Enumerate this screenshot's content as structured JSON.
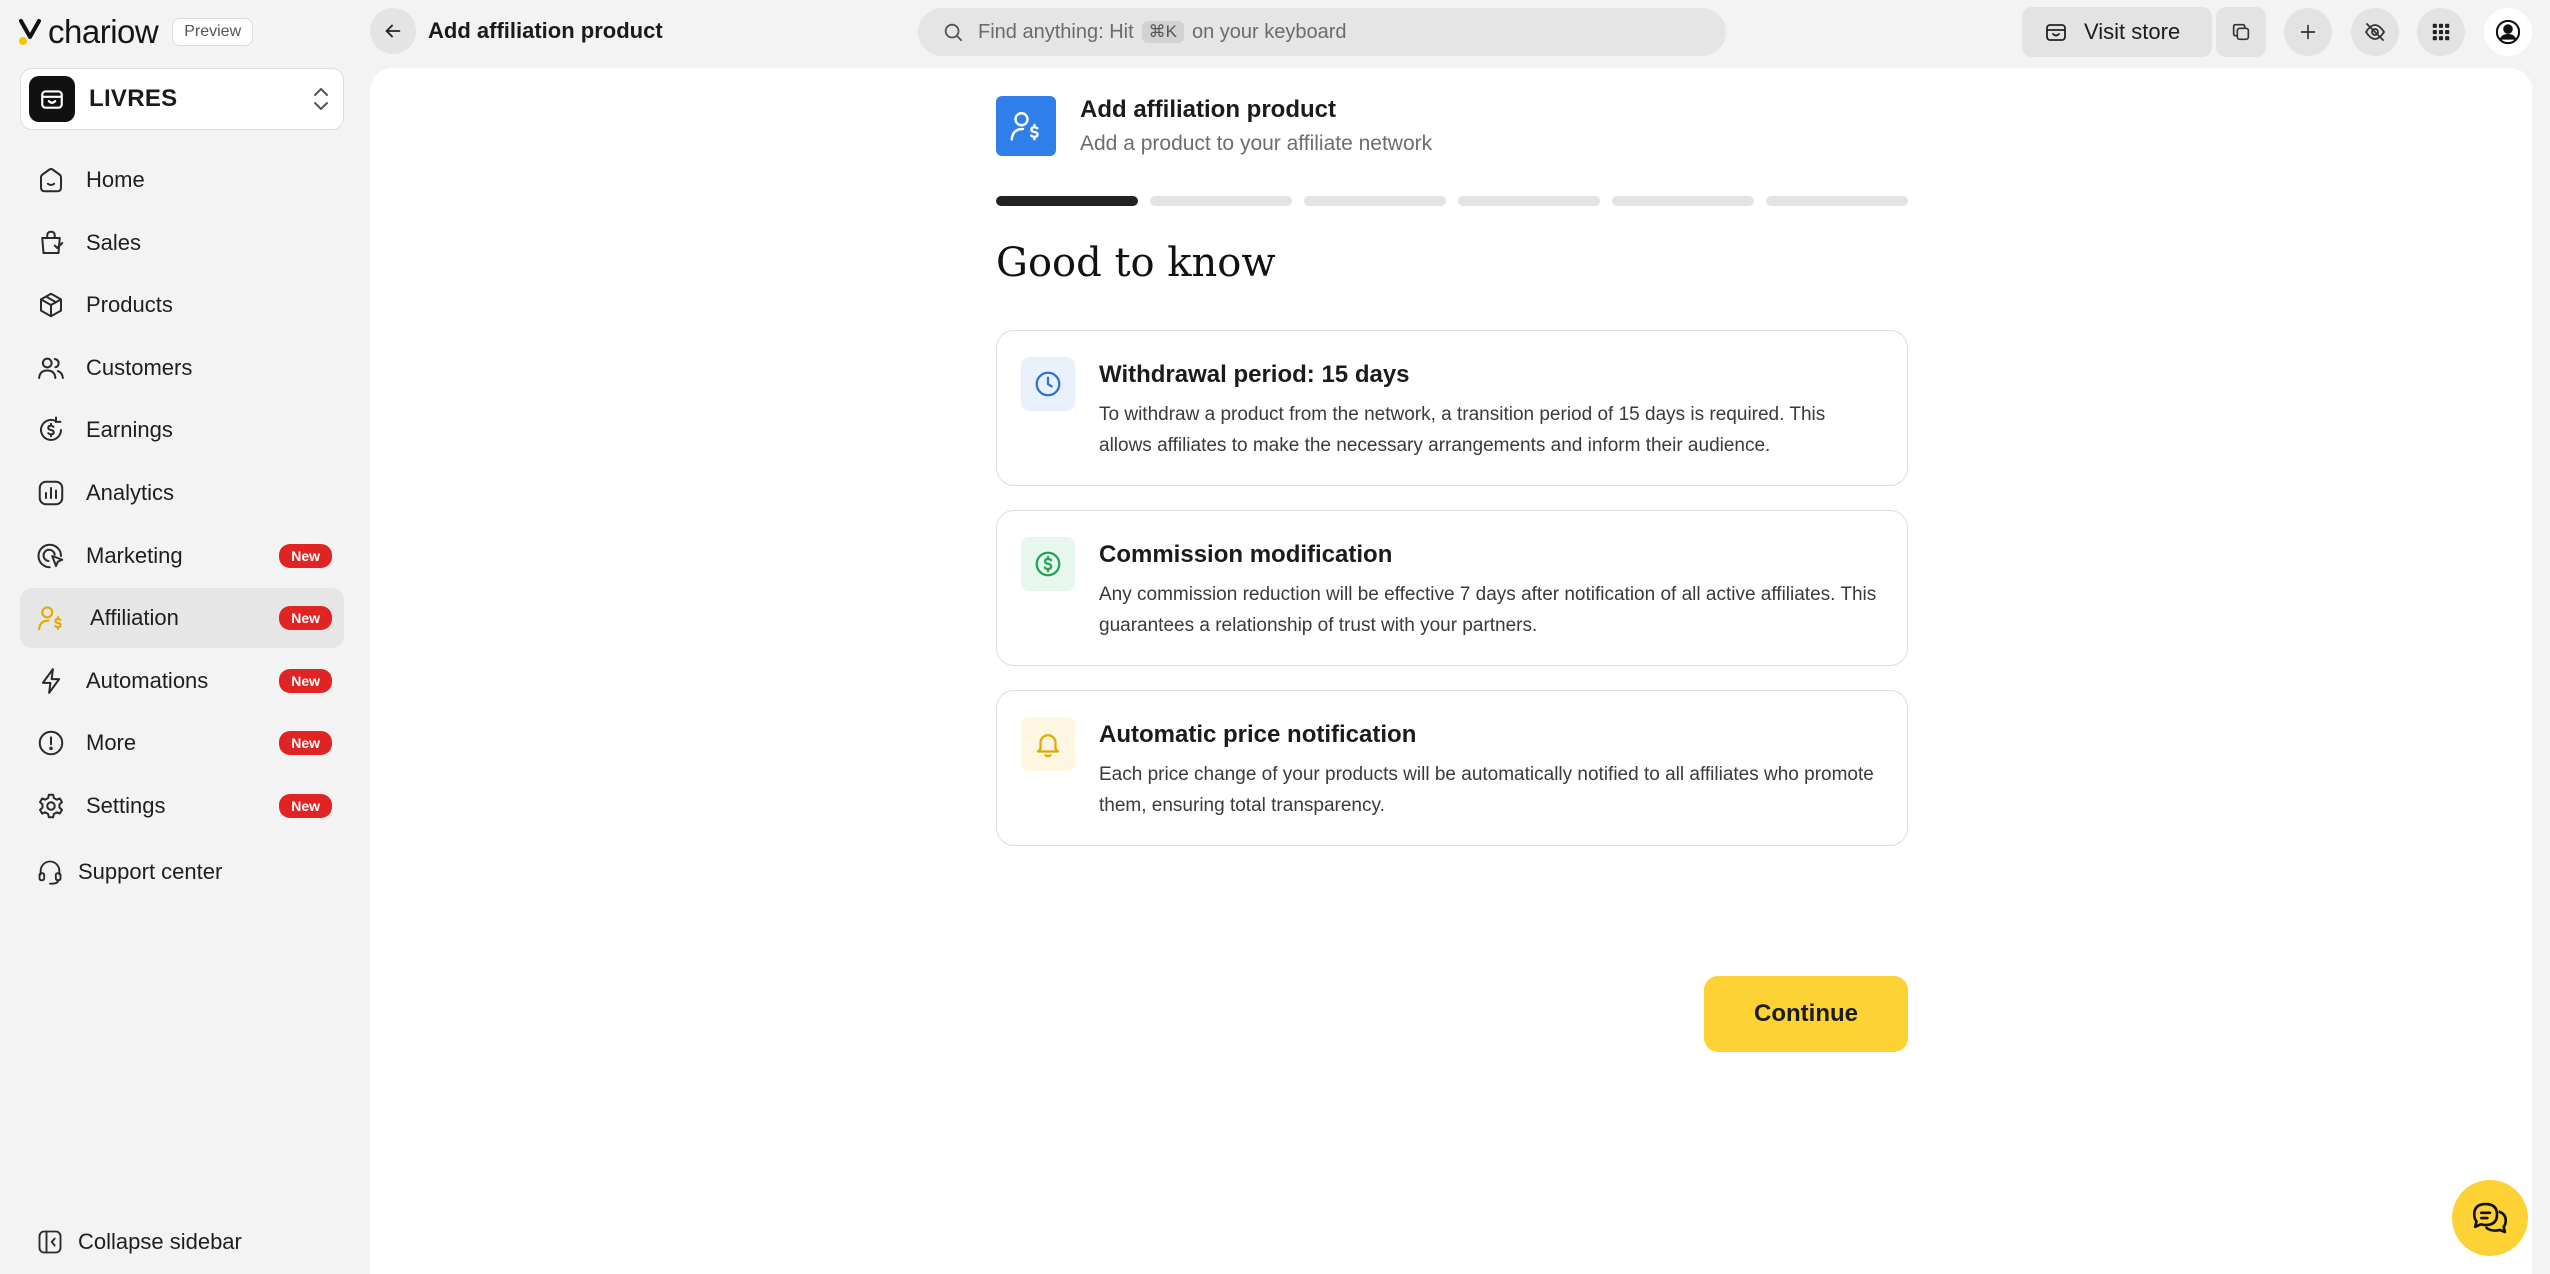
{
  "brand": {
    "name": "chariow",
    "preview_label": "Preview"
  },
  "store": {
    "name": "LIVRES"
  },
  "sidebar": {
    "items": [
      {
        "label": "Home",
        "icon": "home-icon"
      },
      {
        "label": "Sales",
        "icon": "shopping-bag-icon"
      },
      {
        "label": "Products",
        "icon": "box-icon"
      },
      {
        "label": "Customers",
        "icon": "users-icon"
      },
      {
        "label": "Earnings",
        "icon": "dollar-refresh-icon"
      },
      {
        "label": "Analytics",
        "icon": "bar-chart-icon"
      },
      {
        "label": "Marketing",
        "icon": "marketing-icon",
        "badge": "New"
      },
      {
        "label": "Affiliation",
        "icon": "affiliation-icon",
        "badge": "New",
        "active": true
      },
      {
        "label": "Automations",
        "icon": "lightning-icon",
        "badge": "New"
      },
      {
        "label": "More",
        "icon": "info-circle-icon",
        "badge": "New"
      },
      {
        "label": "Settings",
        "icon": "gear-icon",
        "badge": "New"
      }
    ],
    "support_label": "Support center",
    "collapse_label": "Collapse sidebar"
  },
  "topbar": {
    "title": "Add affiliation product",
    "search_prefix": "Find anything: Hit",
    "search_kbd": "⌘K",
    "search_suffix": "on your keyboard",
    "visit_store_label": "Visit store"
  },
  "page": {
    "header_title": "Add affiliation product",
    "header_subtitle": "Add a product to your affiliate network",
    "steps_total": 6,
    "steps_completed": 1,
    "heading": "Good to know",
    "cards": [
      {
        "title": "Withdrawal period: 15 days",
        "text": "To withdraw a product from the network, a transition period of 15 days is required. This allows affiliates to make the necessary arrangements and inform their audience.",
        "icon": "clock-icon",
        "color": "#2f6fd6",
        "bg": "#e9f1fd"
      },
      {
        "title": "Commission modification",
        "text": "Any commission reduction will be effective 7 days after notification of all active affiliates. This guarantees a relationship of trust with your partners.",
        "icon": "dollar-circle-icon",
        "color": "#22a35a",
        "bg": "#e8f7ee"
      },
      {
        "title": "Automatic price notification",
        "text": "Each price change of your products will be automatically notified to all affiliates who promote them, ensuring total transparency.",
        "icon": "bell-icon",
        "color": "#e6a800",
        "bg": "#fdf6e1"
      }
    ],
    "continue_label": "Continue"
  },
  "colors": {
    "accent": "#fdd235",
    "badge": "#e02424",
    "primary_blue": "#2f7ee9"
  }
}
